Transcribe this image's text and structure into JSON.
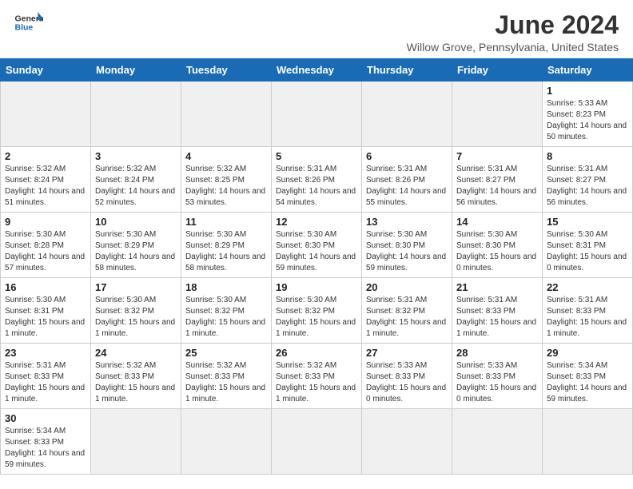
{
  "header": {
    "logo_general": "General",
    "logo_blue": "Blue",
    "month_year": "June 2024",
    "location": "Willow Grove, Pennsylvania, United States"
  },
  "days_of_week": [
    "Sunday",
    "Monday",
    "Tuesday",
    "Wednesday",
    "Thursday",
    "Friday",
    "Saturday"
  ],
  "weeks": [
    [
      {
        "day": "",
        "info": ""
      },
      {
        "day": "",
        "info": ""
      },
      {
        "day": "",
        "info": ""
      },
      {
        "day": "",
        "info": ""
      },
      {
        "day": "",
        "info": ""
      },
      {
        "day": "",
        "info": ""
      },
      {
        "day": "1",
        "info": "Sunrise: 5:33 AM\nSunset: 8:23 PM\nDaylight: 14 hours and 50 minutes."
      }
    ],
    [
      {
        "day": "2",
        "info": "Sunrise: 5:32 AM\nSunset: 8:24 PM\nDaylight: 14 hours and 51 minutes."
      },
      {
        "day": "3",
        "info": "Sunrise: 5:32 AM\nSunset: 8:24 PM\nDaylight: 14 hours and 52 minutes."
      },
      {
        "day": "4",
        "info": "Sunrise: 5:32 AM\nSunset: 8:25 PM\nDaylight: 14 hours and 53 minutes."
      },
      {
        "day": "5",
        "info": "Sunrise: 5:31 AM\nSunset: 8:26 PM\nDaylight: 14 hours and 54 minutes."
      },
      {
        "day": "6",
        "info": "Sunrise: 5:31 AM\nSunset: 8:26 PM\nDaylight: 14 hours and 55 minutes."
      },
      {
        "day": "7",
        "info": "Sunrise: 5:31 AM\nSunset: 8:27 PM\nDaylight: 14 hours and 56 minutes."
      },
      {
        "day": "8",
        "info": "Sunrise: 5:31 AM\nSunset: 8:27 PM\nDaylight: 14 hours and 56 minutes."
      }
    ],
    [
      {
        "day": "9",
        "info": "Sunrise: 5:30 AM\nSunset: 8:28 PM\nDaylight: 14 hours and 57 minutes."
      },
      {
        "day": "10",
        "info": "Sunrise: 5:30 AM\nSunset: 8:29 PM\nDaylight: 14 hours and 58 minutes."
      },
      {
        "day": "11",
        "info": "Sunrise: 5:30 AM\nSunset: 8:29 PM\nDaylight: 14 hours and 58 minutes."
      },
      {
        "day": "12",
        "info": "Sunrise: 5:30 AM\nSunset: 8:30 PM\nDaylight: 14 hours and 59 minutes."
      },
      {
        "day": "13",
        "info": "Sunrise: 5:30 AM\nSunset: 8:30 PM\nDaylight: 14 hours and 59 minutes."
      },
      {
        "day": "14",
        "info": "Sunrise: 5:30 AM\nSunset: 8:30 PM\nDaylight: 15 hours and 0 minutes."
      },
      {
        "day": "15",
        "info": "Sunrise: 5:30 AM\nSunset: 8:31 PM\nDaylight: 15 hours and 0 minutes."
      }
    ],
    [
      {
        "day": "16",
        "info": "Sunrise: 5:30 AM\nSunset: 8:31 PM\nDaylight: 15 hours and 1 minute."
      },
      {
        "day": "17",
        "info": "Sunrise: 5:30 AM\nSunset: 8:32 PM\nDaylight: 15 hours and 1 minute."
      },
      {
        "day": "18",
        "info": "Sunrise: 5:30 AM\nSunset: 8:32 PM\nDaylight: 15 hours and 1 minute."
      },
      {
        "day": "19",
        "info": "Sunrise: 5:30 AM\nSunset: 8:32 PM\nDaylight: 15 hours and 1 minute."
      },
      {
        "day": "20",
        "info": "Sunrise: 5:31 AM\nSunset: 8:32 PM\nDaylight: 15 hours and 1 minute."
      },
      {
        "day": "21",
        "info": "Sunrise: 5:31 AM\nSunset: 8:33 PM\nDaylight: 15 hours and 1 minute."
      },
      {
        "day": "22",
        "info": "Sunrise: 5:31 AM\nSunset: 8:33 PM\nDaylight: 15 hours and 1 minute."
      }
    ],
    [
      {
        "day": "23",
        "info": "Sunrise: 5:31 AM\nSunset: 8:33 PM\nDaylight: 15 hours and 1 minute."
      },
      {
        "day": "24",
        "info": "Sunrise: 5:32 AM\nSunset: 8:33 PM\nDaylight: 15 hours and 1 minute."
      },
      {
        "day": "25",
        "info": "Sunrise: 5:32 AM\nSunset: 8:33 PM\nDaylight: 15 hours and 1 minute."
      },
      {
        "day": "26",
        "info": "Sunrise: 5:32 AM\nSunset: 8:33 PM\nDaylight: 15 hours and 1 minute."
      },
      {
        "day": "27",
        "info": "Sunrise: 5:33 AM\nSunset: 8:33 PM\nDaylight: 15 hours and 0 minutes."
      },
      {
        "day": "28",
        "info": "Sunrise: 5:33 AM\nSunset: 8:33 PM\nDaylight: 15 hours and 0 minutes."
      },
      {
        "day": "29",
        "info": "Sunrise: 5:34 AM\nSunset: 8:33 PM\nDaylight: 14 hours and 59 minutes."
      }
    ],
    [
      {
        "day": "30",
        "info": "Sunrise: 5:34 AM\nSunset: 8:33 PM\nDaylight: 14 hours and 59 minutes."
      },
      {
        "day": "",
        "info": ""
      },
      {
        "day": "",
        "info": ""
      },
      {
        "day": "",
        "info": ""
      },
      {
        "day": "",
        "info": ""
      },
      {
        "day": "",
        "info": ""
      },
      {
        "day": "",
        "info": ""
      }
    ]
  ]
}
